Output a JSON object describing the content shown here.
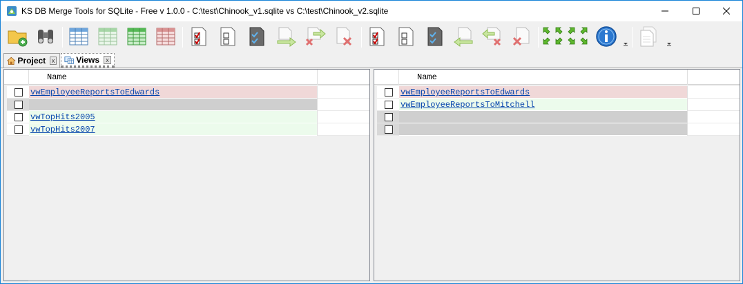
{
  "window": {
    "title": "KS DB Merge Tools for SQLite - Free v 1.0.0 - C:\\test\\Chinook_v1.sqlite vs C:\\test\\Chinook_v2.sqlite"
  },
  "toolbar": {
    "buttons": [
      "open-project",
      "compare-binoculars",
      "table-view",
      "table-view-green-left",
      "table-view-green-right",
      "table-view-red",
      "check-all",
      "uncheck-all",
      "check-selected",
      "copy-checked-right",
      "delete-checked-right",
      "delete-right",
      "check-all-2",
      "uncheck-all-2",
      "check-selected-2",
      "copy-checked-left",
      "delete-checked-left",
      "delete-left",
      "nav-arrows",
      "info",
      "report"
    ]
  },
  "tabs": [
    {
      "label": "Project",
      "close": "x",
      "active": false
    },
    {
      "label": "Views",
      "close": "x",
      "active": true
    }
  ],
  "left": {
    "column_header": "Name",
    "rows": [
      {
        "name": "vwEmployeeReportsToEdwards",
        "status": "red"
      },
      {
        "name": "",
        "status": "gray"
      },
      {
        "name": "vwTopHits2005",
        "status": "green"
      },
      {
        "name": "vwTopHits2007",
        "status": "green"
      }
    ]
  },
  "right": {
    "column_header": "Name",
    "rows": [
      {
        "name": "vwEmployeeReportsToEdwards",
        "status": "red"
      },
      {
        "name": "vwEmployeeReportsToMitchell",
        "status": "green"
      },
      {
        "name": "",
        "status": "gray"
      },
      {
        "name": "",
        "status": "gray"
      }
    ]
  },
  "colors": {
    "removed": "#f0d8d8",
    "added": "#ecfbec",
    "missing": "#cfcfcf",
    "link": "#0645ad"
  }
}
